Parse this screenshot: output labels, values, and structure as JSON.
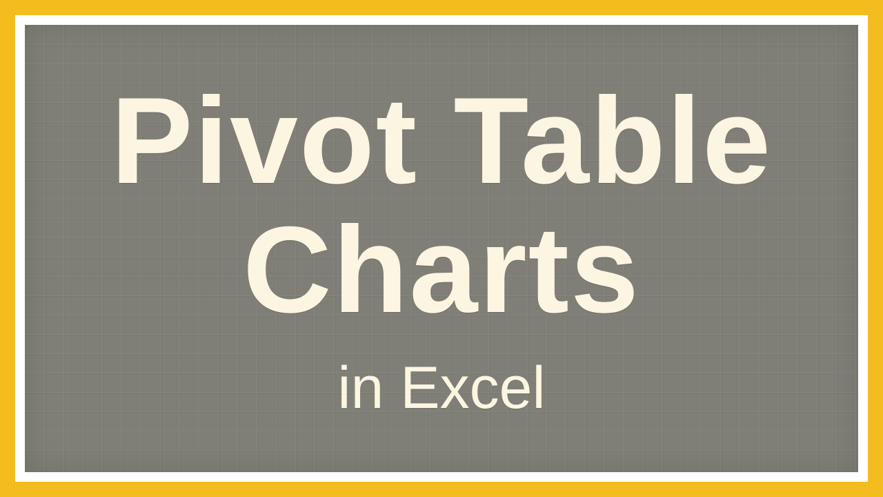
{
  "colors": {
    "outerBorder": "#f4bd1f",
    "innerBorder": "#ffffff",
    "boardBackground": "#7f7f77",
    "textColor": "#fcf5e1"
  },
  "title": {
    "line1": "Pivot Table",
    "line2": "Charts"
  },
  "subtitle": "in Excel"
}
